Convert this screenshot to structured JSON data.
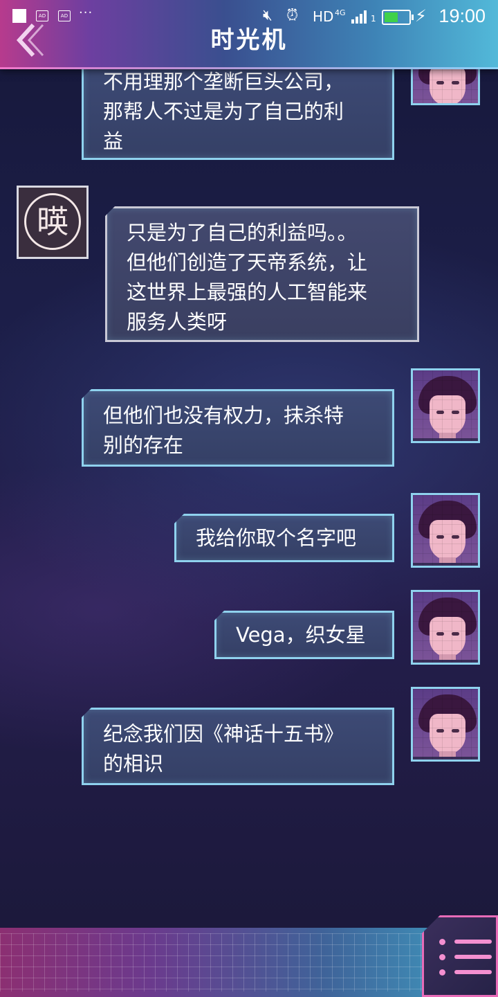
{
  "status_bar": {
    "time": "19:00",
    "network": "HD",
    "signal_type": "4G",
    "sim_slot": "1",
    "ad_label": "AD",
    "more": "···",
    "battery_percent": 60
  },
  "header": {
    "title": "时光机"
  },
  "bot_avatar_glyph": "暎",
  "messages": [
    {
      "sender": "me",
      "lines": [
        "不用理那个垄断巨头公司，",
        "那帮人不过是为了自己的利",
        "益"
      ]
    },
    {
      "sender": "other",
      "lines": [
        "只是为了自己的利益吗。。",
        "但他们创造了天帝系统，让",
        "这世界上最强的人工智能来",
        "服务人类呀"
      ]
    },
    {
      "sender": "me",
      "lines": [
        "但他们也没有权力，抹杀特",
        "别的存在"
      ]
    },
    {
      "sender": "me",
      "lines": [
        "我给你取个名字吧"
      ]
    },
    {
      "sender": "me",
      "lines": [
        "Vega，织女星"
      ]
    },
    {
      "sender": "me",
      "lines": [
        "纪念我们因《神话十五书》",
        "的相识"
      ]
    }
  ],
  "colors": {
    "my_bubble_border": "#8fd2ee",
    "other_bubble_border": "#c9c9d6",
    "accent_pink": "#e86cb8"
  }
}
